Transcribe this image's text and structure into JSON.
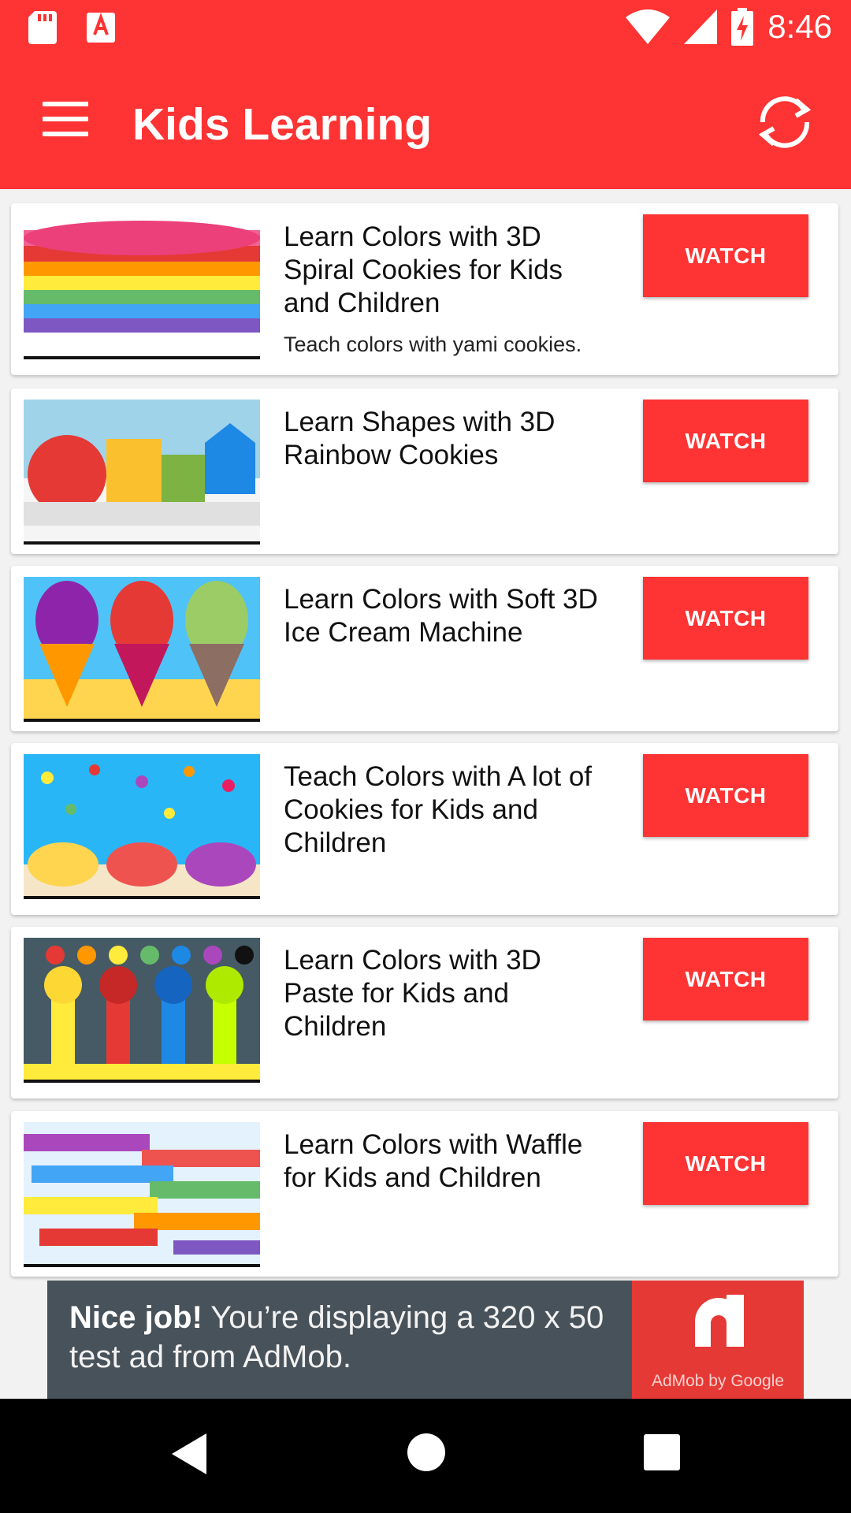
{
  "status_bar": {
    "time": "8:46",
    "icons": [
      "sd-card-icon",
      "font-app-icon",
      "wifi-icon",
      "signal-icon",
      "battery-charging-icon"
    ]
  },
  "app_bar": {
    "title": "Kids Learning",
    "menu_icon": "hamburger-menu-icon",
    "refresh_icon": "refresh-icon"
  },
  "videos": [
    {
      "title": "Learn Colors with 3D Spiral Cookies for Kids and Children",
      "description": "Teach colors with yami cookies.",
      "button": "WATCH",
      "thumbnail": "rainbow-cookie-stack"
    },
    {
      "title": "Learn Shapes with 3D Rainbow Cookies",
      "description": "",
      "button": "WATCH",
      "thumbnail": "shape-cookies"
    },
    {
      "title": "Learn Colors with Soft 3D Ice Cream Machine",
      "description": "",
      "button": "WATCH",
      "thumbnail": "ice-cream-cones"
    },
    {
      "title": "Teach Colors with A lot of Cookies for Kids and Children",
      "description": "",
      "button": "WATCH",
      "thumbnail": "cookie-bowls"
    },
    {
      "title": "Learn Colors with 3D Paste for Kids and Children",
      "description": "",
      "button": "WATCH",
      "thumbnail": "paste-tubes"
    },
    {
      "title": "Learn Colors with Waffle for Kids and Children",
      "description": "",
      "button": "WATCH",
      "thumbnail": "rainbow-waffles"
    }
  ],
  "ad": {
    "headline": "Nice job!",
    "body": "You’re displaying a 320 x 50 test ad from AdMob.",
    "logo_caption": "AdMob by Google"
  },
  "colors": {
    "primary": "#fe3333",
    "ad_background": "#48525a",
    "ad_logo_background": "#e53935",
    "nav_bar": "#000000"
  }
}
